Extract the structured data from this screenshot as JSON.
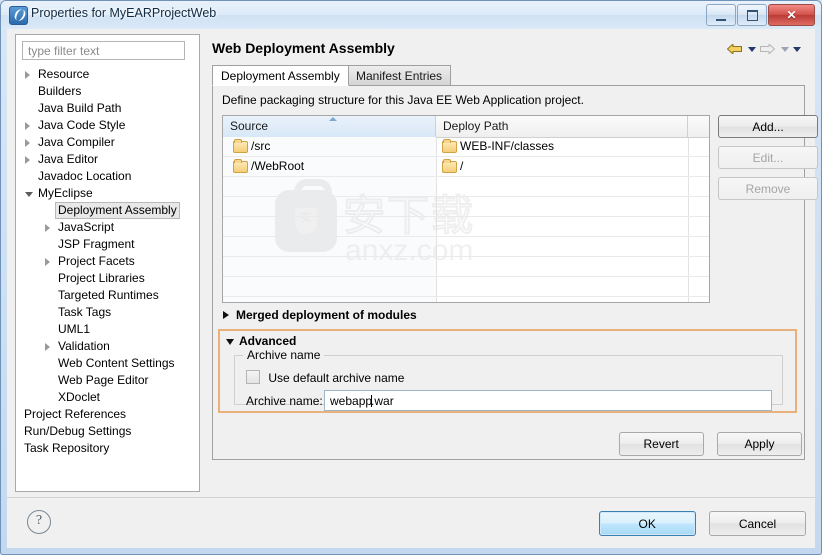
{
  "window": {
    "title": "Properties for MyEARProjectWeb",
    "icon": "myeclipse-icon",
    "minimize_label": "",
    "maximize_label": "",
    "close_label": "✕"
  },
  "sidebar": {
    "filter": {
      "placeholder": "type filter text",
      "value": ""
    },
    "items": [
      {
        "label": "Resource",
        "indent": 0,
        "twisty": "closed",
        "selected": false
      },
      {
        "label": "Builders",
        "indent": 0,
        "twisty": "none",
        "selected": false
      },
      {
        "label": "Java Build Path",
        "indent": 0,
        "twisty": "none",
        "selected": false
      },
      {
        "label": "Java Code Style",
        "indent": 0,
        "twisty": "closed",
        "selected": false
      },
      {
        "label": "Java Compiler",
        "indent": 0,
        "twisty": "closed",
        "selected": false
      },
      {
        "label": "Java Editor",
        "indent": 0,
        "twisty": "closed",
        "selected": false
      },
      {
        "label": "Javadoc Location",
        "indent": 0,
        "twisty": "none",
        "selected": false
      },
      {
        "label": "MyEclipse",
        "indent": 0,
        "twisty": "open",
        "selected": false
      },
      {
        "label": "Deployment Assembly",
        "indent": 1,
        "twisty": "none",
        "selected": true
      },
      {
        "label": "JavaScript",
        "indent": 1,
        "twisty": "closed",
        "selected": false
      },
      {
        "label": "JSP Fragment",
        "indent": 1,
        "twisty": "none",
        "selected": false
      },
      {
        "label": "Project Facets",
        "indent": 1,
        "twisty": "closed",
        "selected": false
      },
      {
        "label": "Project Libraries",
        "indent": 1,
        "twisty": "none",
        "selected": false
      },
      {
        "label": "Targeted Runtimes",
        "indent": 1,
        "twisty": "none",
        "selected": false
      },
      {
        "label": "Task Tags",
        "indent": 1,
        "twisty": "none",
        "selected": false
      },
      {
        "label": "UML1",
        "indent": 1,
        "twisty": "none",
        "selected": false
      },
      {
        "label": "Validation",
        "indent": 1,
        "twisty": "closed",
        "selected": false
      },
      {
        "label": "Web Content Settings",
        "indent": 1,
        "twisty": "none",
        "selected": false
      },
      {
        "label": "Web Page Editor",
        "indent": 1,
        "twisty": "none",
        "selected": false
      },
      {
        "label": "XDoclet",
        "indent": 1,
        "twisty": "none",
        "selected": false
      },
      {
        "label": "Project References",
        "indent": -1,
        "twisty": "none",
        "selected": false
      },
      {
        "label": "Run/Debug Settings",
        "indent": -1,
        "twisty": "none",
        "selected": false
      },
      {
        "label": "Task Repository",
        "indent": -1,
        "twisty": "none",
        "selected": false
      }
    ]
  },
  "page": {
    "title": "Web Deployment Assembly",
    "nav": {
      "back": "back-arrow",
      "forward": "forward-arrow",
      "menu": "dropdown-arrow"
    },
    "tabs": [
      {
        "label": "Deployment Assembly",
        "active": true
      },
      {
        "label": "Manifest Entries",
        "active": false
      }
    ],
    "description": "Define packaging structure for this Java EE Web Application project.",
    "table": {
      "columns": [
        "Source",
        "Deploy Path"
      ],
      "sorted_column": "Source",
      "rows": [
        {
          "source": "/src",
          "deploy": "WEB-INF/classes"
        },
        {
          "source": "/WebRoot",
          "deploy": "/"
        }
      ]
    },
    "side_buttons": [
      {
        "label": "Add...",
        "enabled": true
      },
      {
        "label": "Edit...",
        "enabled": false
      },
      {
        "label": "Remove",
        "enabled": false
      }
    ],
    "watermark": {
      "cn": "安下载",
      "domain": "anxz.com",
      "shield_glyph": "安"
    },
    "merged_section": {
      "label": "Merged deployment of modules",
      "expanded": false
    },
    "advanced_section": {
      "label": "Advanced",
      "expanded": true,
      "group_label": "Archive name",
      "checkbox_label": "Use default archive name",
      "checkbox_checked": false,
      "field_label": "Archive name:",
      "field_value_before_caret": "webapp",
      "field_value_after_caret": ".war"
    },
    "revert_label": "Revert",
    "apply_label": "Apply"
  },
  "footer": {
    "help_label": "?",
    "ok_label": "OK",
    "cancel_label": "Cancel"
  },
  "colors": {
    "highlight_border": "#e8b07a",
    "default_button": "#3c7fb1",
    "close_button": "#c0392b"
  }
}
